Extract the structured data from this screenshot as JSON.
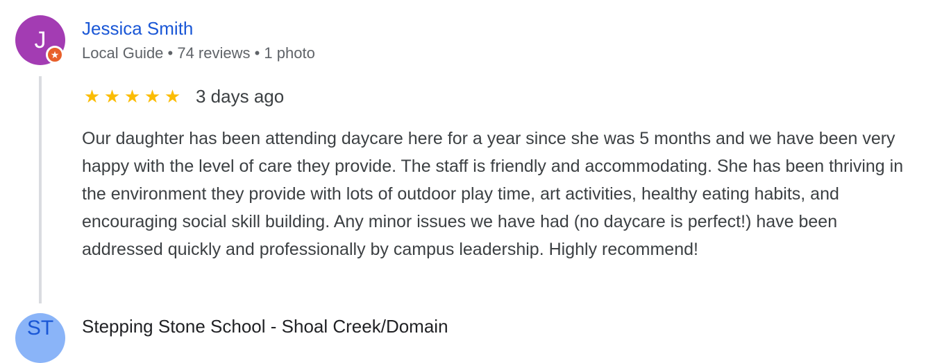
{
  "review": {
    "reviewer": {
      "initial": "J",
      "name": "Jessica Smith",
      "meta": "Local Guide • 74 reviews • 1 photo",
      "avatar_color": "#a33cb3",
      "badge_icon": "star-icon"
    },
    "rating": {
      "stars": 5,
      "max": 5,
      "star_glyph": "★",
      "star_color": "#fbbc04"
    },
    "date": "3 days ago",
    "text": "Our daughter has been attending daycare here for a year since she was 5 months and we have been very happy with the level of care they provide. The staff is friendly and accommodating. She has been thriving in the environment they provide with lots of outdoor play time, art activities, healthy eating habits, and encouraging social skill building. Any minor issues we have had (no daycare is perfect!) have been addressed quickly and professionally by campus leadership. Highly recommend!"
  },
  "next_response": {
    "initial": "ST",
    "name": "Stepping Stone School - Shoal Creek/Domain",
    "avatar_color": "#8ab4f8"
  },
  "colors": {
    "link_blue": "#1a57d6",
    "meta_gray": "#5f6368",
    "text_dark": "#3c4043",
    "divider": "#dadce0",
    "badge_orange": "#e8602b"
  }
}
